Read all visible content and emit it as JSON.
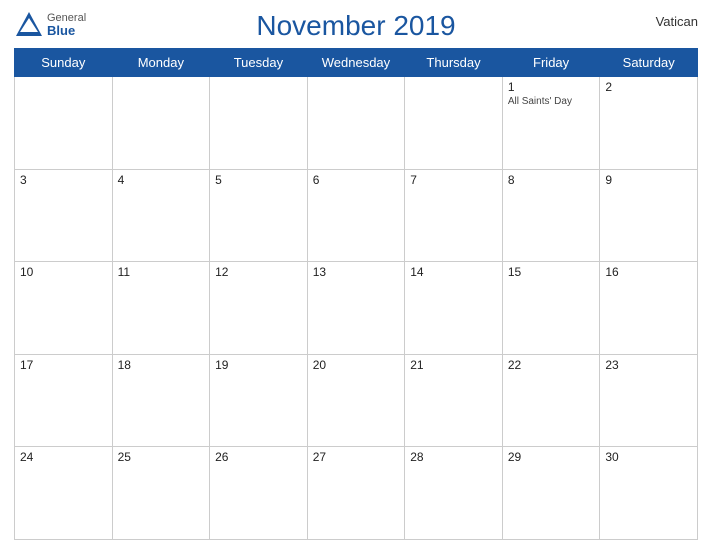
{
  "header": {
    "title": "November 2019",
    "region": "Vatican",
    "logo": {
      "general": "General",
      "blue": "Blue"
    }
  },
  "weekdays": [
    "Sunday",
    "Monday",
    "Tuesday",
    "Wednesday",
    "Thursday",
    "Friday",
    "Saturday"
  ],
  "weeks": [
    [
      {
        "day": "",
        "empty": true
      },
      {
        "day": "",
        "empty": true
      },
      {
        "day": "",
        "empty": true
      },
      {
        "day": "",
        "empty": true
      },
      {
        "day": "",
        "empty": true
      },
      {
        "day": "1",
        "event": "All Saints' Day"
      },
      {
        "day": "2"
      }
    ],
    [
      {
        "day": "3"
      },
      {
        "day": "4"
      },
      {
        "day": "5"
      },
      {
        "day": "6"
      },
      {
        "day": "7"
      },
      {
        "day": "8"
      },
      {
        "day": "9"
      }
    ],
    [
      {
        "day": "10"
      },
      {
        "day": "11"
      },
      {
        "day": "12"
      },
      {
        "day": "13"
      },
      {
        "day": "14"
      },
      {
        "day": "15"
      },
      {
        "day": "16"
      }
    ],
    [
      {
        "day": "17"
      },
      {
        "day": "18"
      },
      {
        "day": "19"
      },
      {
        "day": "20"
      },
      {
        "day": "21"
      },
      {
        "day": "22"
      },
      {
        "day": "23"
      }
    ],
    [
      {
        "day": "24"
      },
      {
        "day": "25"
      },
      {
        "day": "26"
      },
      {
        "day": "27"
      },
      {
        "day": "28"
      },
      {
        "day": "29"
      },
      {
        "day": "30"
      }
    ]
  ]
}
